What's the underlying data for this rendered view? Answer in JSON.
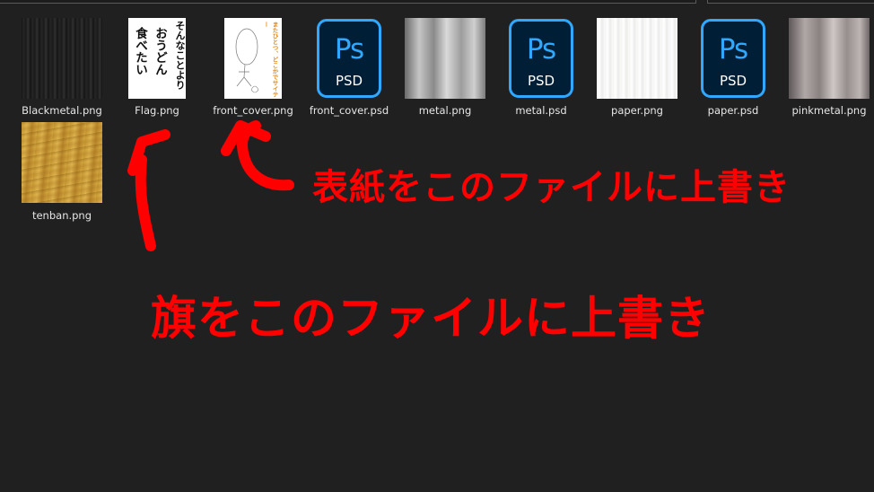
{
  "files": [
    {
      "name": "Blackmetal.png",
      "kind": "blackmetal"
    },
    {
      "name": "Flag.png",
      "kind": "flag",
      "thumb_text": [
        "そんなことより",
        "おうどん",
        "食べたい"
      ]
    },
    {
      "name": "front_cover.png",
      "kind": "cover",
      "thumb_text": "またひとつ、どこかでサイテー"
    },
    {
      "name": "front_cover.psd",
      "kind": "psd"
    },
    {
      "name": "metal.png",
      "kind": "metal"
    },
    {
      "name": "metal.psd",
      "kind": "psd"
    },
    {
      "name": "paper.png",
      "kind": "paper"
    },
    {
      "name": "paper.psd",
      "kind": "psd"
    },
    {
      "name": "pinkmetal.png",
      "kind": "pinkmetal"
    },
    {
      "name": "tenban.png",
      "kind": "tenban"
    }
  ],
  "ps_icon": {
    "logo": "Ps",
    "label": "PSD"
  },
  "annotations": {
    "cover_note": "表紙をこのファイルに上書き",
    "flag_note": "旗をこのファイルに上書き"
  },
  "colors": {
    "background": "#202020",
    "annotation": "#ff0000",
    "ps_blue": "#31a8ff",
    "ps_dark": "#001e36"
  }
}
